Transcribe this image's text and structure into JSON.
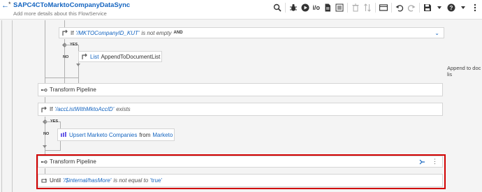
{
  "header": {
    "back_icon": "back-arrow-icon",
    "title": "SAPC4CToMarktoCompanyDataSync",
    "subtitle": "Add more details about this FlowService",
    "toolbar": [
      {
        "name": "search-icon"
      },
      {
        "name": "debug-icon"
      },
      {
        "name": "run-icon"
      },
      {
        "name": "io-toggle",
        "label": "i/o"
      },
      {
        "name": "document-icon"
      },
      {
        "name": "list-icon"
      },
      {
        "name": "delete-icon",
        "disabled": true
      },
      {
        "name": "sort-icon",
        "disabled": true
      },
      {
        "name": "layout-icon"
      },
      {
        "name": "undo-icon"
      },
      {
        "name": "redo-icon",
        "disabled": true
      },
      {
        "name": "save-icon"
      },
      {
        "name": "help-icon"
      },
      {
        "name": "more-icon"
      }
    ]
  },
  "steps": {
    "if1": {
      "keyword": "If",
      "variable": "'/MKTOCompanyID_KUT'",
      "condition": "is not empty",
      "operator": "AND"
    },
    "yes1": "YES",
    "no1": "NO",
    "list1": {
      "keyword": "List",
      "service": "AppendToDocumentList"
    },
    "append_note": "Append to doc lis",
    "transform1": {
      "label": "Transform Pipeline"
    },
    "if2": {
      "keyword": "If",
      "variable": "'/accListWithMktoAccID'",
      "condition": "exists"
    },
    "yes2": "YES",
    "no2": "NO",
    "upsert": {
      "service": "Upsert Marketo Companies",
      "from": "from",
      "connector": "Marketo"
    },
    "transform2": {
      "label": "Transform Pipeline"
    },
    "until": {
      "keyword": "Until",
      "variable": "'/$internal/hasMore'",
      "condition": "is not equal to",
      "value": "'true'"
    }
  }
}
